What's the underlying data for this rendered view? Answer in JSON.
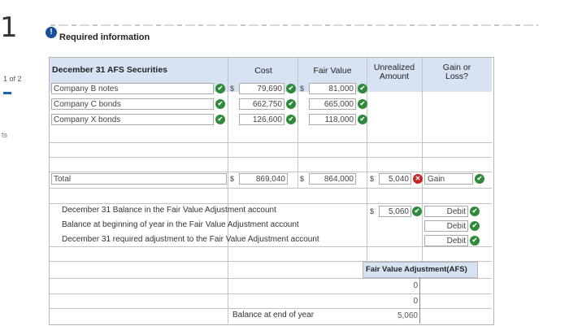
{
  "question": {
    "number": "1",
    "pager": "1 of 2",
    "side_fragment": "ts",
    "required_info": "Required information"
  },
  "colors": {
    "header_bg": "#d7e2f2",
    "check_green": "#2f8a3b",
    "error_red": "#c62828",
    "info_blue": "#1a4fa0"
  },
  "table": {
    "headers": {
      "securities": "December 31 AFS Securities",
      "cost": "Cost",
      "fair_value": "Fair Value",
      "unrealized_1": "Unrealized",
      "unrealized_2": "Amount",
      "gain_loss_1": "Gain or",
      "gain_loss_2": "Loss?"
    },
    "currency": "$",
    "rows": [
      {
        "name": "Company B notes",
        "cost": "79,690",
        "fair_value": "81,000"
      },
      {
        "name": "Company C bonds",
        "cost": "662,750",
        "fair_value": "665,000"
      },
      {
        "name": "Company X bonds",
        "cost": "126,600",
        "fair_value": "118,000"
      }
    ],
    "total": {
      "label": "Total",
      "cost": "869,040",
      "fair_value": "864,000",
      "unrealized": "5,040",
      "gain_loss": "Gain"
    }
  },
  "adjustments": {
    "rows": [
      {
        "label": "December 31 Balance in the Fair Value Adjustment account",
        "amount": "5,060",
        "type": "Debit"
      },
      {
        "label": "Balance at beginning of year in the Fair Value Adjustment account",
        "type": "Debit"
      },
      {
        "label": "December 31 required adjustment to the Fair Value Adjustment account",
        "type": "Debit"
      }
    ]
  },
  "t_account": {
    "title": "Fair Value Adjustment(AFS)",
    "values": [
      "0",
      "0",
      "5,060"
    ],
    "balance_label": "Balance at end of year"
  }
}
